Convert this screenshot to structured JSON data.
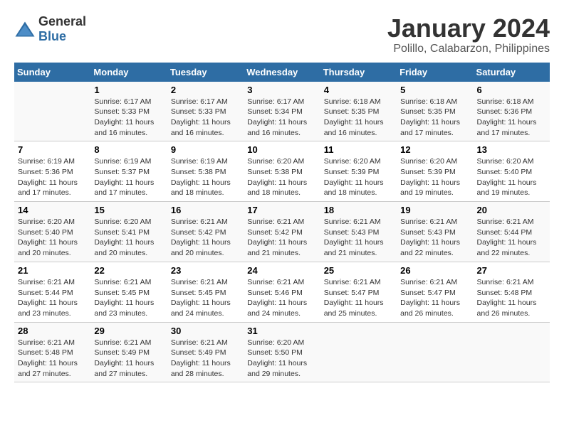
{
  "logo": {
    "general": "General",
    "blue": "Blue"
  },
  "title": "January 2024",
  "subtitle": "Polillo, Calabarzon, Philippines",
  "headers": [
    "Sunday",
    "Monday",
    "Tuesday",
    "Wednesday",
    "Thursday",
    "Friday",
    "Saturday"
  ],
  "weeks": [
    [
      {
        "day": "",
        "sunrise": "",
        "sunset": "",
        "daylight": ""
      },
      {
        "day": "1",
        "sunrise": "Sunrise: 6:17 AM",
        "sunset": "Sunset: 5:33 PM",
        "daylight": "Daylight: 11 hours and 16 minutes."
      },
      {
        "day": "2",
        "sunrise": "Sunrise: 6:17 AM",
        "sunset": "Sunset: 5:33 PM",
        "daylight": "Daylight: 11 hours and 16 minutes."
      },
      {
        "day": "3",
        "sunrise": "Sunrise: 6:17 AM",
        "sunset": "Sunset: 5:34 PM",
        "daylight": "Daylight: 11 hours and 16 minutes."
      },
      {
        "day": "4",
        "sunrise": "Sunrise: 6:18 AM",
        "sunset": "Sunset: 5:35 PM",
        "daylight": "Daylight: 11 hours and 16 minutes."
      },
      {
        "day": "5",
        "sunrise": "Sunrise: 6:18 AM",
        "sunset": "Sunset: 5:35 PM",
        "daylight": "Daylight: 11 hours and 17 minutes."
      },
      {
        "day": "6",
        "sunrise": "Sunrise: 6:18 AM",
        "sunset": "Sunset: 5:36 PM",
        "daylight": "Daylight: 11 hours and 17 minutes."
      }
    ],
    [
      {
        "day": "7",
        "sunrise": "Sunrise: 6:19 AM",
        "sunset": "Sunset: 5:36 PM",
        "daylight": "Daylight: 11 hours and 17 minutes."
      },
      {
        "day": "8",
        "sunrise": "Sunrise: 6:19 AM",
        "sunset": "Sunset: 5:37 PM",
        "daylight": "Daylight: 11 hours and 17 minutes."
      },
      {
        "day": "9",
        "sunrise": "Sunrise: 6:19 AM",
        "sunset": "Sunset: 5:38 PM",
        "daylight": "Daylight: 11 hours and 18 minutes."
      },
      {
        "day": "10",
        "sunrise": "Sunrise: 6:20 AM",
        "sunset": "Sunset: 5:38 PM",
        "daylight": "Daylight: 11 hours and 18 minutes."
      },
      {
        "day": "11",
        "sunrise": "Sunrise: 6:20 AM",
        "sunset": "Sunset: 5:39 PM",
        "daylight": "Daylight: 11 hours and 18 minutes."
      },
      {
        "day": "12",
        "sunrise": "Sunrise: 6:20 AM",
        "sunset": "Sunset: 5:39 PM",
        "daylight": "Daylight: 11 hours and 19 minutes."
      },
      {
        "day": "13",
        "sunrise": "Sunrise: 6:20 AM",
        "sunset": "Sunset: 5:40 PM",
        "daylight": "Daylight: 11 hours and 19 minutes."
      }
    ],
    [
      {
        "day": "14",
        "sunrise": "Sunrise: 6:20 AM",
        "sunset": "Sunset: 5:40 PM",
        "daylight": "Daylight: 11 hours and 20 minutes."
      },
      {
        "day": "15",
        "sunrise": "Sunrise: 6:20 AM",
        "sunset": "Sunset: 5:41 PM",
        "daylight": "Daylight: 11 hours and 20 minutes."
      },
      {
        "day": "16",
        "sunrise": "Sunrise: 6:21 AM",
        "sunset": "Sunset: 5:42 PM",
        "daylight": "Daylight: 11 hours and 20 minutes."
      },
      {
        "day": "17",
        "sunrise": "Sunrise: 6:21 AM",
        "sunset": "Sunset: 5:42 PM",
        "daylight": "Daylight: 11 hours and 21 minutes."
      },
      {
        "day": "18",
        "sunrise": "Sunrise: 6:21 AM",
        "sunset": "Sunset: 5:43 PM",
        "daylight": "Daylight: 11 hours and 21 minutes."
      },
      {
        "day": "19",
        "sunrise": "Sunrise: 6:21 AM",
        "sunset": "Sunset: 5:43 PM",
        "daylight": "Daylight: 11 hours and 22 minutes."
      },
      {
        "day": "20",
        "sunrise": "Sunrise: 6:21 AM",
        "sunset": "Sunset: 5:44 PM",
        "daylight": "Daylight: 11 hours and 22 minutes."
      }
    ],
    [
      {
        "day": "21",
        "sunrise": "Sunrise: 6:21 AM",
        "sunset": "Sunset: 5:44 PM",
        "daylight": "Daylight: 11 hours and 23 minutes."
      },
      {
        "day": "22",
        "sunrise": "Sunrise: 6:21 AM",
        "sunset": "Sunset: 5:45 PM",
        "daylight": "Daylight: 11 hours and 23 minutes."
      },
      {
        "day": "23",
        "sunrise": "Sunrise: 6:21 AM",
        "sunset": "Sunset: 5:45 PM",
        "daylight": "Daylight: 11 hours and 24 minutes."
      },
      {
        "day": "24",
        "sunrise": "Sunrise: 6:21 AM",
        "sunset": "Sunset: 5:46 PM",
        "daylight": "Daylight: 11 hours and 24 minutes."
      },
      {
        "day": "25",
        "sunrise": "Sunrise: 6:21 AM",
        "sunset": "Sunset: 5:47 PM",
        "daylight": "Daylight: 11 hours and 25 minutes."
      },
      {
        "day": "26",
        "sunrise": "Sunrise: 6:21 AM",
        "sunset": "Sunset: 5:47 PM",
        "daylight": "Daylight: 11 hours and 26 minutes."
      },
      {
        "day": "27",
        "sunrise": "Sunrise: 6:21 AM",
        "sunset": "Sunset: 5:48 PM",
        "daylight": "Daylight: 11 hours and 26 minutes."
      }
    ],
    [
      {
        "day": "28",
        "sunrise": "Sunrise: 6:21 AM",
        "sunset": "Sunset: 5:48 PM",
        "daylight": "Daylight: 11 hours and 27 minutes."
      },
      {
        "day": "29",
        "sunrise": "Sunrise: 6:21 AM",
        "sunset": "Sunset: 5:49 PM",
        "daylight": "Daylight: 11 hours and 27 minutes."
      },
      {
        "day": "30",
        "sunrise": "Sunrise: 6:21 AM",
        "sunset": "Sunset: 5:49 PM",
        "daylight": "Daylight: 11 hours and 28 minutes."
      },
      {
        "day": "31",
        "sunrise": "Sunrise: 6:20 AM",
        "sunset": "Sunset: 5:50 PM",
        "daylight": "Daylight: 11 hours and 29 minutes."
      },
      {
        "day": "",
        "sunrise": "",
        "sunset": "",
        "daylight": ""
      },
      {
        "day": "",
        "sunrise": "",
        "sunset": "",
        "daylight": ""
      },
      {
        "day": "",
        "sunrise": "",
        "sunset": "",
        "daylight": ""
      }
    ]
  ]
}
